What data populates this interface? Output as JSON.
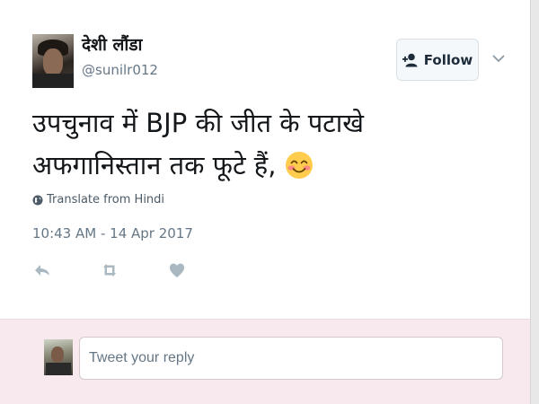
{
  "tweet": {
    "display_name": "देशी लौंडा",
    "handle": "@sunilr012",
    "text_line1": "उपचुनाव में BJP की जीत के पटाखे",
    "text_line2": "अफगानिस्तान तक फूटे हैं,",
    "emoji": "smiling-face-with-smiling-eyes",
    "translate_label": "Translate from Hindi",
    "timestamp": "10:43 AM - 14 Apr 2017"
  },
  "follow": {
    "label": "Follow"
  },
  "actions": [
    "reply-icon",
    "retweet-icon",
    "like-icon"
  ],
  "reply": {
    "placeholder": "Tweet your reply"
  },
  "colors": {
    "text": "#14171a",
    "secondary": "#657786",
    "action_icon": "#aab8c2",
    "reply_bg": "#f7e9ee",
    "follow_text": "#1d2b3a"
  }
}
